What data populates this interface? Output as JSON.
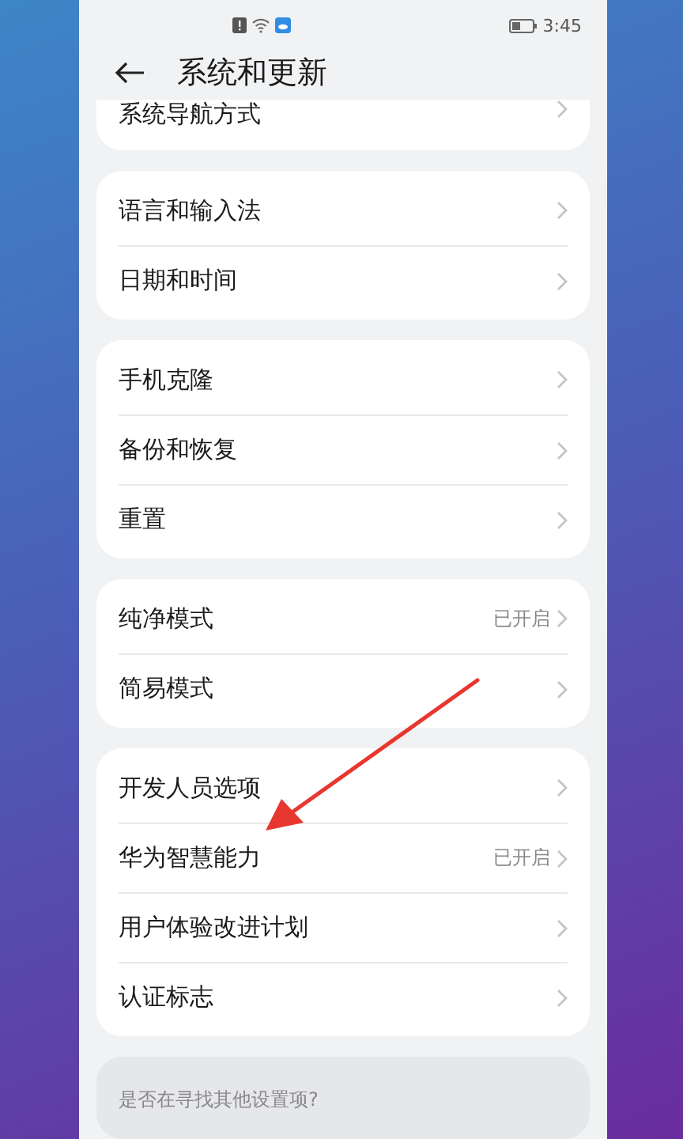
{
  "status_bar": {
    "time": "3:45"
  },
  "header": {
    "title": "系统和更新"
  },
  "groups": [
    {
      "items": [
        {
          "label": "系统导航方式"
        }
      ],
      "cut": true
    },
    {
      "items": [
        {
          "label": "语言和输入法"
        },
        {
          "label": "日期和时间"
        }
      ]
    },
    {
      "items": [
        {
          "label": "手机克隆"
        },
        {
          "label": "备份和恢复"
        },
        {
          "label": "重置"
        }
      ]
    },
    {
      "items": [
        {
          "label": "纯净模式",
          "value": "已开启"
        },
        {
          "label": "简易模式"
        }
      ]
    },
    {
      "items": [
        {
          "label": "开发人员选项"
        },
        {
          "label": "华为智慧能力",
          "value": "已开启"
        },
        {
          "label": "用户体验改进计划"
        },
        {
          "label": "认证标志"
        }
      ]
    }
  ],
  "suggestion": {
    "text": "是否在寻找其他设置项?"
  }
}
